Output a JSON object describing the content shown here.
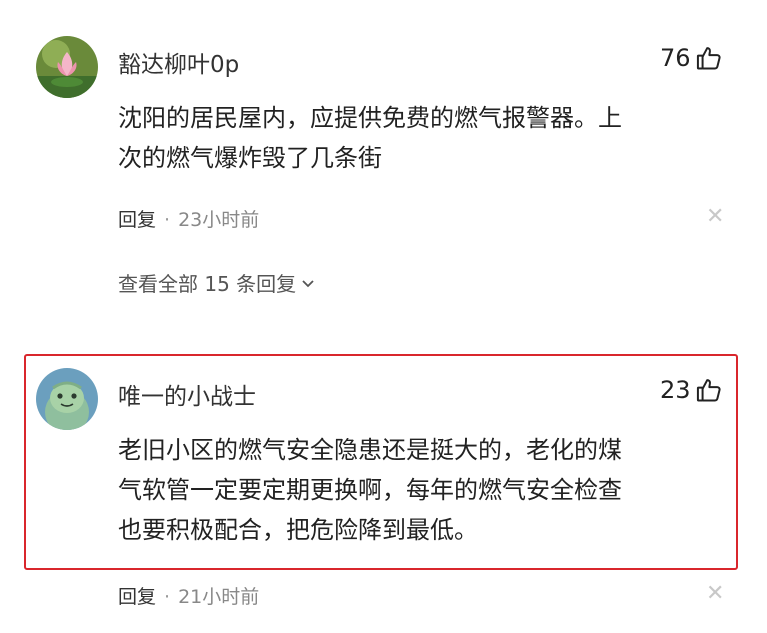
{
  "comments": [
    {
      "username": "豁达柳叶0p",
      "likes": "76",
      "text_line1": "沈阳的居民屋内，应提供免费的燃气报警器。上",
      "text_line2": "次的燃气爆炸毁了几条街",
      "reply_label": "回复",
      "separator": "·",
      "time": "23小时前",
      "view_replies": "查看全部 15 条回复"
    },
    {
      "username": "唯一的小战士",
      "likes": "23",
      "text_line1": "老旧小区的燃气安全隐患还是挺大的，老化的煤",
      "text_line2": "气软管一定要定期更换啊，每年的燃气安全检查",
      "text_line3": "也要积极配合，把危险降到最低。",
      "reply_label": "回复",
      "separator": "·",
      "time": "21小时前"
    }
  ],
  "icons": {
    "like": "thumbs-up-icon",
    "close": "close-icon",
    "expand": "chevron-down-icon"
  },
  "colors": {
    "highlight_border": "#d9262c",
    "meta_text": "#888888"
  }
}
